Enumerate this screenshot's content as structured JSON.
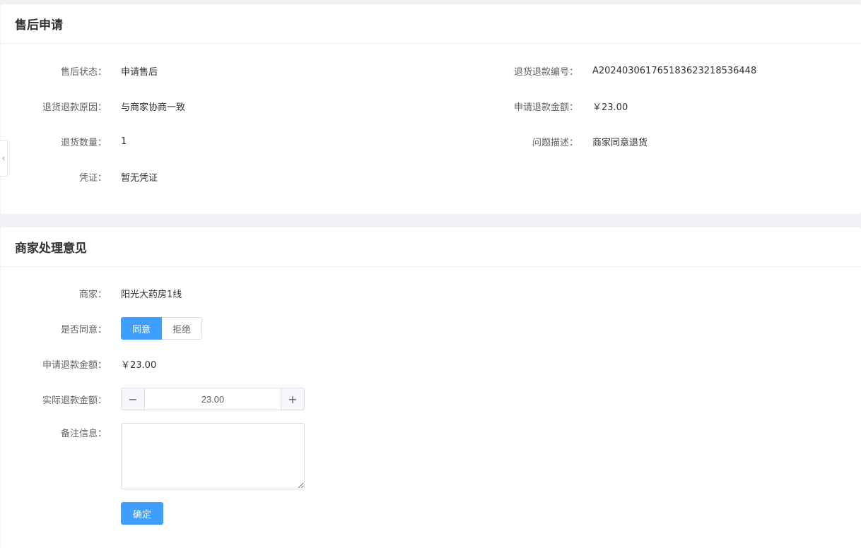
{
  "after_sale": {
    "title": "售后申请",
    "fields_left": [
      {
        "label": "售后状态：",
        "value": "申请售后"
      },
      {
        "label": "退货退款原因：",
        "value": "与商家协商一致"
      },
      {
        "label": "退货数量：",
        "value": "1"
      },
      {
        "label": "凭证：",
        "value": "暂无凭证"
      }
    ],
    "fields_right": [
      {
        "label": "退货退款编号：",
        "value": "A202403061765183623218536448"
      },
      {
        "label": "申请退款金额：",
        "value": "￥23.00"
      },
      {
        "label": "问题描述：",
        "value": "商家同意退货"
      }
    ]
  },
  "merchant": {
    "title": "商家处理意见",
    "merchant_label": "商家：",
    "merchant_value": "阳光大药房1线",
    "agree_label": "是否同意：",
    "agree_options": [
      "同意",
      "拒绝"
    ],
    "selected_option": "同意",
    "apply_amount_label": "申请退款金额：",
    "apply_amount_value": "￥23.00",
    "actual_amount_label": "实际退款金额：",
    "actual_amount_value": "23.00",
    "remark_label": "备注信息：",
    "remark_value": "",
    "submit_label": "确定"
  },
  "icons": {
    "side_tab": "chevron-left-icon",
    "decrement": "minus-icon",
    "increment": "plus-icon"
  },
  "colors": {
    "primary": "#409eff",
    "background": "#f0f2f5"
  }
}
